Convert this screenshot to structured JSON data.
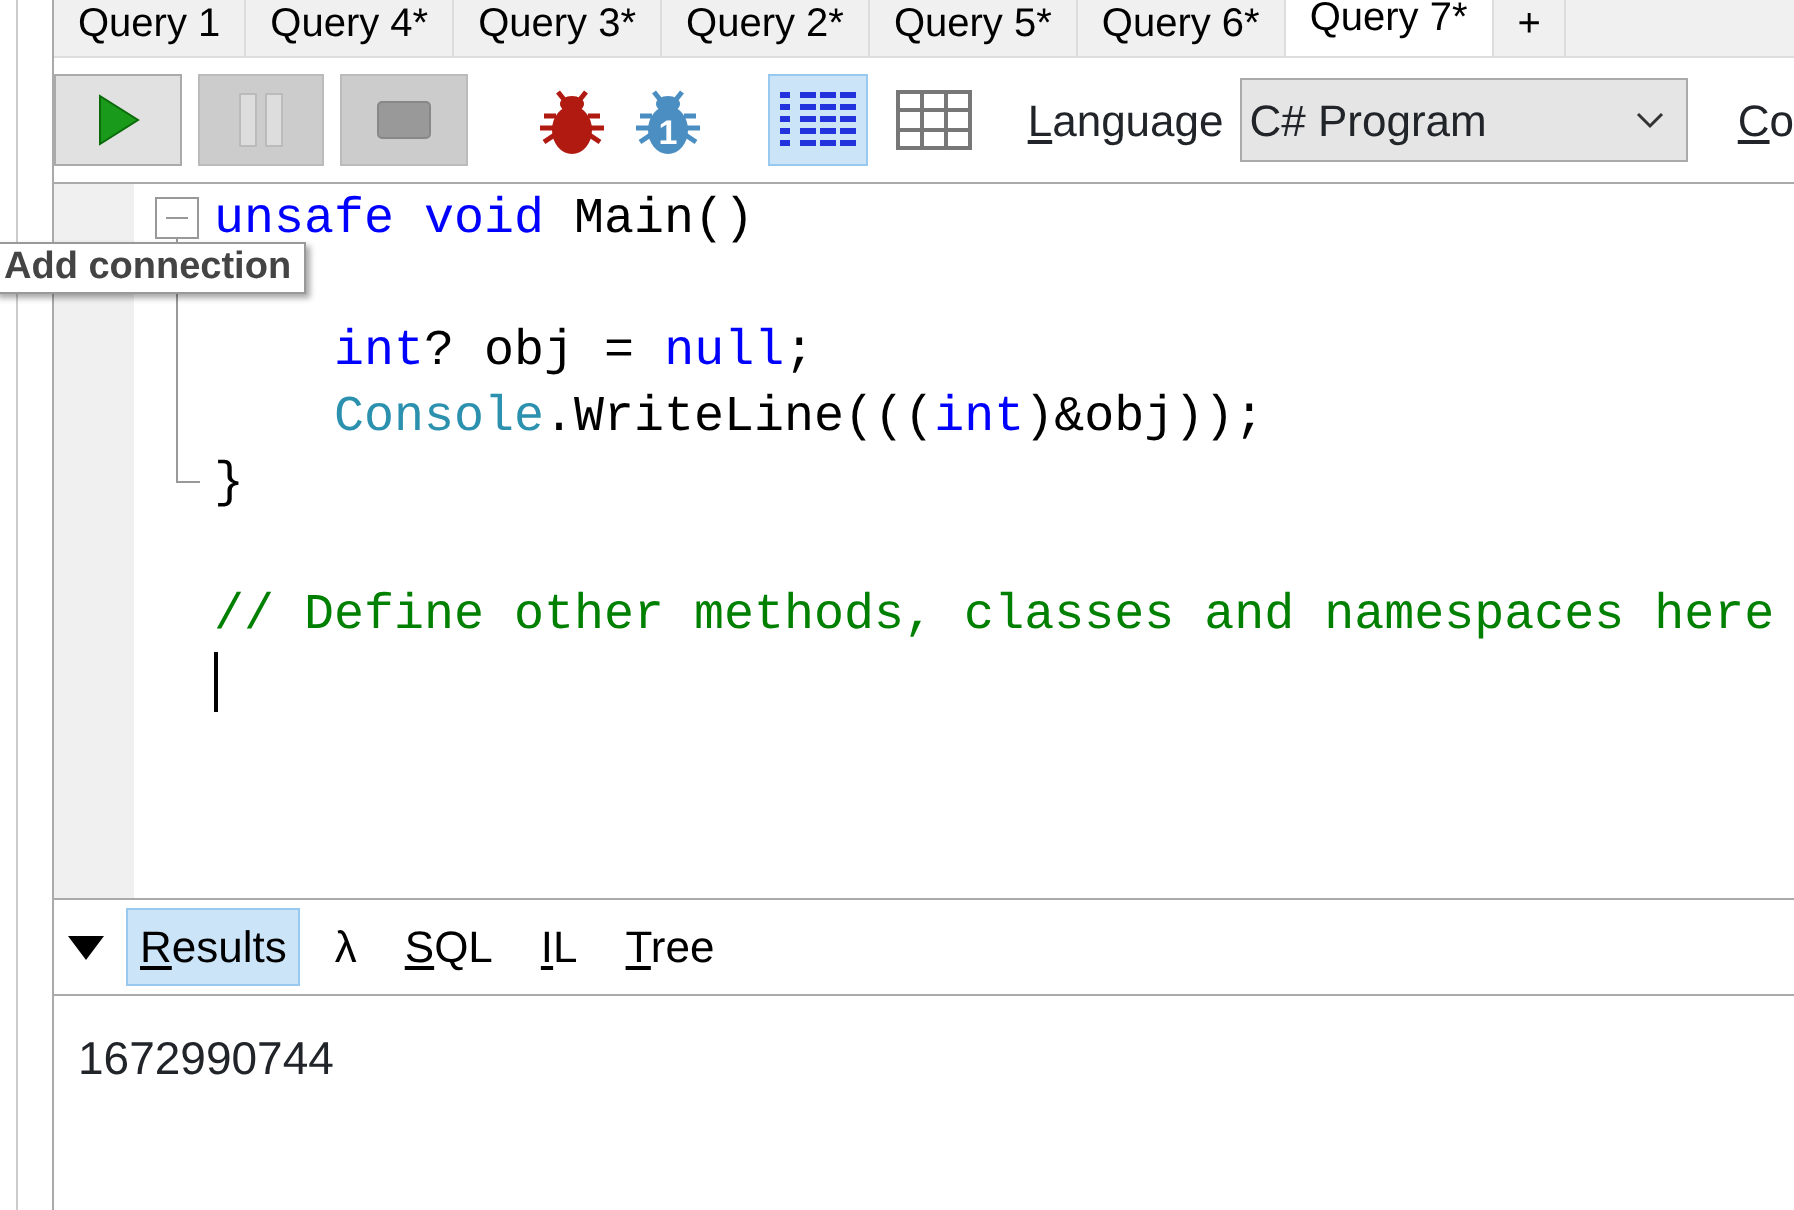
{
  "tabs": [
    {
      "label": "Query 1",
      "selected": false
    },
    {
      "label": "Query 4*",
      "selected": false
    },
    {
      "label": "Query 3*",
      "selected": false
    },
    {
      "label": "Query 2*",
      "selected": false
    },
    {
      "label": "Query 5*",
      "selected": false
    },
    {
      "label": "Query 6*",
      "selected": false
    },
    {
      "label": "Query 7*",
      "selected": true
    },
    {
      "label": "+",
      "selected": false
    }
  ],
  "toolbar": {
    "buttons": [
      {
        "kind": "run",
        "disabled": false
      },
      {
        "kind": "pause",
        "disabled": true
      },
      {
        "kind": "stop",
        "disabled": true
      }
    ],
    "debug_icons": [
      {
        "kind": "bug"
      },
      {
        "kind": "bug-step",
        "badge": "1"
      }
    ],
    "view_toggles": [
      {
        "kind": "rich-text",
        "selected": true
      },
      {
        "kind": "grid",
        "selected": false
      }
    ],
    "language": {
      "label": "Language",
      "mnemonic": true,
      "value": "C# Program"
    },
    "next_label": {
      "text": "Co",
      "mnemonic": true
    }
  },
  "editor": {
    "folded": false,
    "lines": [
      {
        "kind": "code",
        "tokens": [
          {
            "kind": "kw",
            "t": "unsafe"
          },
          {
            "kind": "kw",
            "t": " void"
          },
          {
            "kind": "plain",
            "t": " Main()"
          }
        ]
      },
      {
        "kind": "blank"
      },
      {
        "kind": "code",
        "tokens": [
          {
            "kind": "kw",
            "t": "    int"
          },
          {
            "kind": "plain",
            "t": "? obj = "
          },
          {
            "kind": "kw",
            "t": "null"
          },
          {
            "kind": "plain",
            "t": ";"
          }
        ]
      },
      {
        "kind": "code",
        "tokens": [
          {
            "kind": "type",
            "t": "    Console"
          },
          {
            "kind": "plain",
            "t": ".WriteLine((("
          },
          {
            "kind": "kw",
            "t": "int"
          },
          {
            "kind": "plain",
            "t": ")&obj));"
          }
        ]
      },
      {
        "kind": "code",
        "tokens": [
          {
            "kind": "plain",
            "t": "}"
          }
        ]
      },
      {
        "kind": "blank"
      },
      {
        "kind": "code",
        "tokens": [
          {
            "kind": "comment",
            "t": "// Define other methods, classes and namespaces here"
          }
        ]
      },
      {
        "kind": "cursor"
      }
    ]
  },
  "tooltip": {
    "text": "Add connection"
  },
  "results": {
    "expanded": true,
    "tabs": [
      {
        "label": "Results",
        "mnemonic": true,
        "selected": true
      },
      {
        "label": "λ",
        "mnemonic": false,
        "selected": false
      },
      {
        "label": "SQL",
        "mnemonic": true,
        "selected": false
      },
      {
        "label": "IL",
        "mnemonic": true,
        "selected": false
      },
      {
        "label": "Tree",
        "mnemonic": true,
        "selected": false
      }
    ],
    "output": "1672990744"
  }
}
